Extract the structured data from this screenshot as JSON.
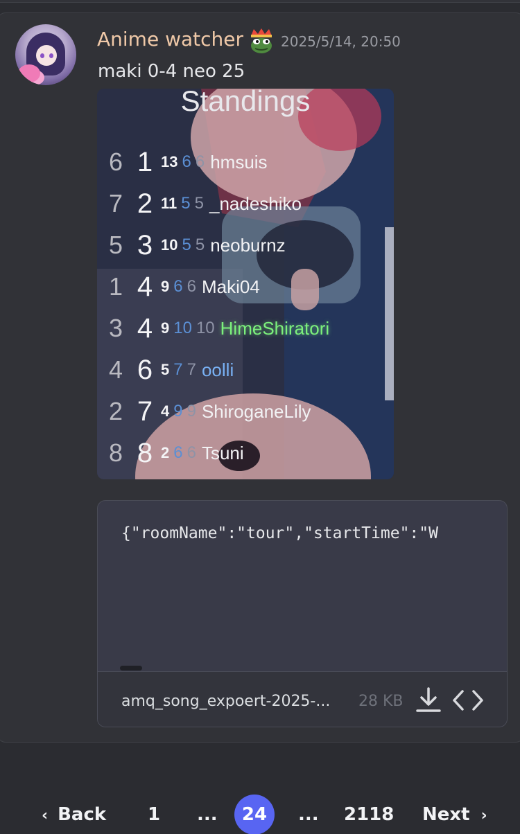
{
  "message": {
    "username": "Anime watcher",
    "timestamp": "2025/5/14, 20:50",
    "text": "maki 0-4 neo 25",
    "role_icon": "frog-with-crown-icon",
    "avatar": "anime-avatar"
  },
  "image": {
    "title": "Standings",
    "rows": [
      {
        "prev": "6",
        "rank": "1",
        "score": "13",
        "a": "6",
        "b": "6",
        "name": "hmsuis",
        "color": "#f2f2f4"
      },
      {
        "prev": "7",
        "rank": "2",
        "score": "11",
        "a": "5",
        "b": "5",
        "name": "_nadeshiko",
        "color": "#f2f2f4"
      },
      {
        "prev": "5",
        "rank": "3",
        "score": "10",
        "a": "5",
        "b": "5",
        "name": "neoburnz",
        "color": "#f2f2f4"
      },
      {
        "prev": "1",
        "rank": "4",
        "score": "9",
        "a": "6",
        "b": "6",
        "name": "Maki04",
        "color": "#f2f2f4"
      },
      {
        "prev": "3",
        "rank": "4",
        "score": "9",
        "a": "10",
        "b": "10",
        "name": "HimeShiratori",
        "color": "#7cf07c"
      },
      {
        "prev": "4",
        "rank": "6",
        "score": "5",
        "a": "7",
        "b": "7",
        "name": "oolli",
        "color": "#79b1f4"
      },
      {
        "prev": "2",
        "rank": "7",
        "score": "4",
        "a": "9",
        "b": "9",
        "name": "ShiroganeLily",
        "color": "#f2f2f4"
      },
      {
        "prev": "8",
        "rank": "8",
        "score": "2",
        "a": "6",
        "b": "6",
        "name": "Tsuni",
        "color": "#f2f2f4"
      }
    ]
  },
  "file": {
    "preview": "{\"roomName\":\"tour\",\"startTime\":\"W",
    "name": "amq_song_expoert-2025-...",
    "size": "28 KB",
    "download_icon": "download-icon",
    "code_icon": "code-icon"
  },
  "pagination": {
    "back": "Back",
    "first": "1",
    "ellipsis_left": "...",
    "current": "24",
    "ellipsis_right": "...",
    "last": "2118",
    "next": "Next",
    "accent": "#5865f2"
  }
}
